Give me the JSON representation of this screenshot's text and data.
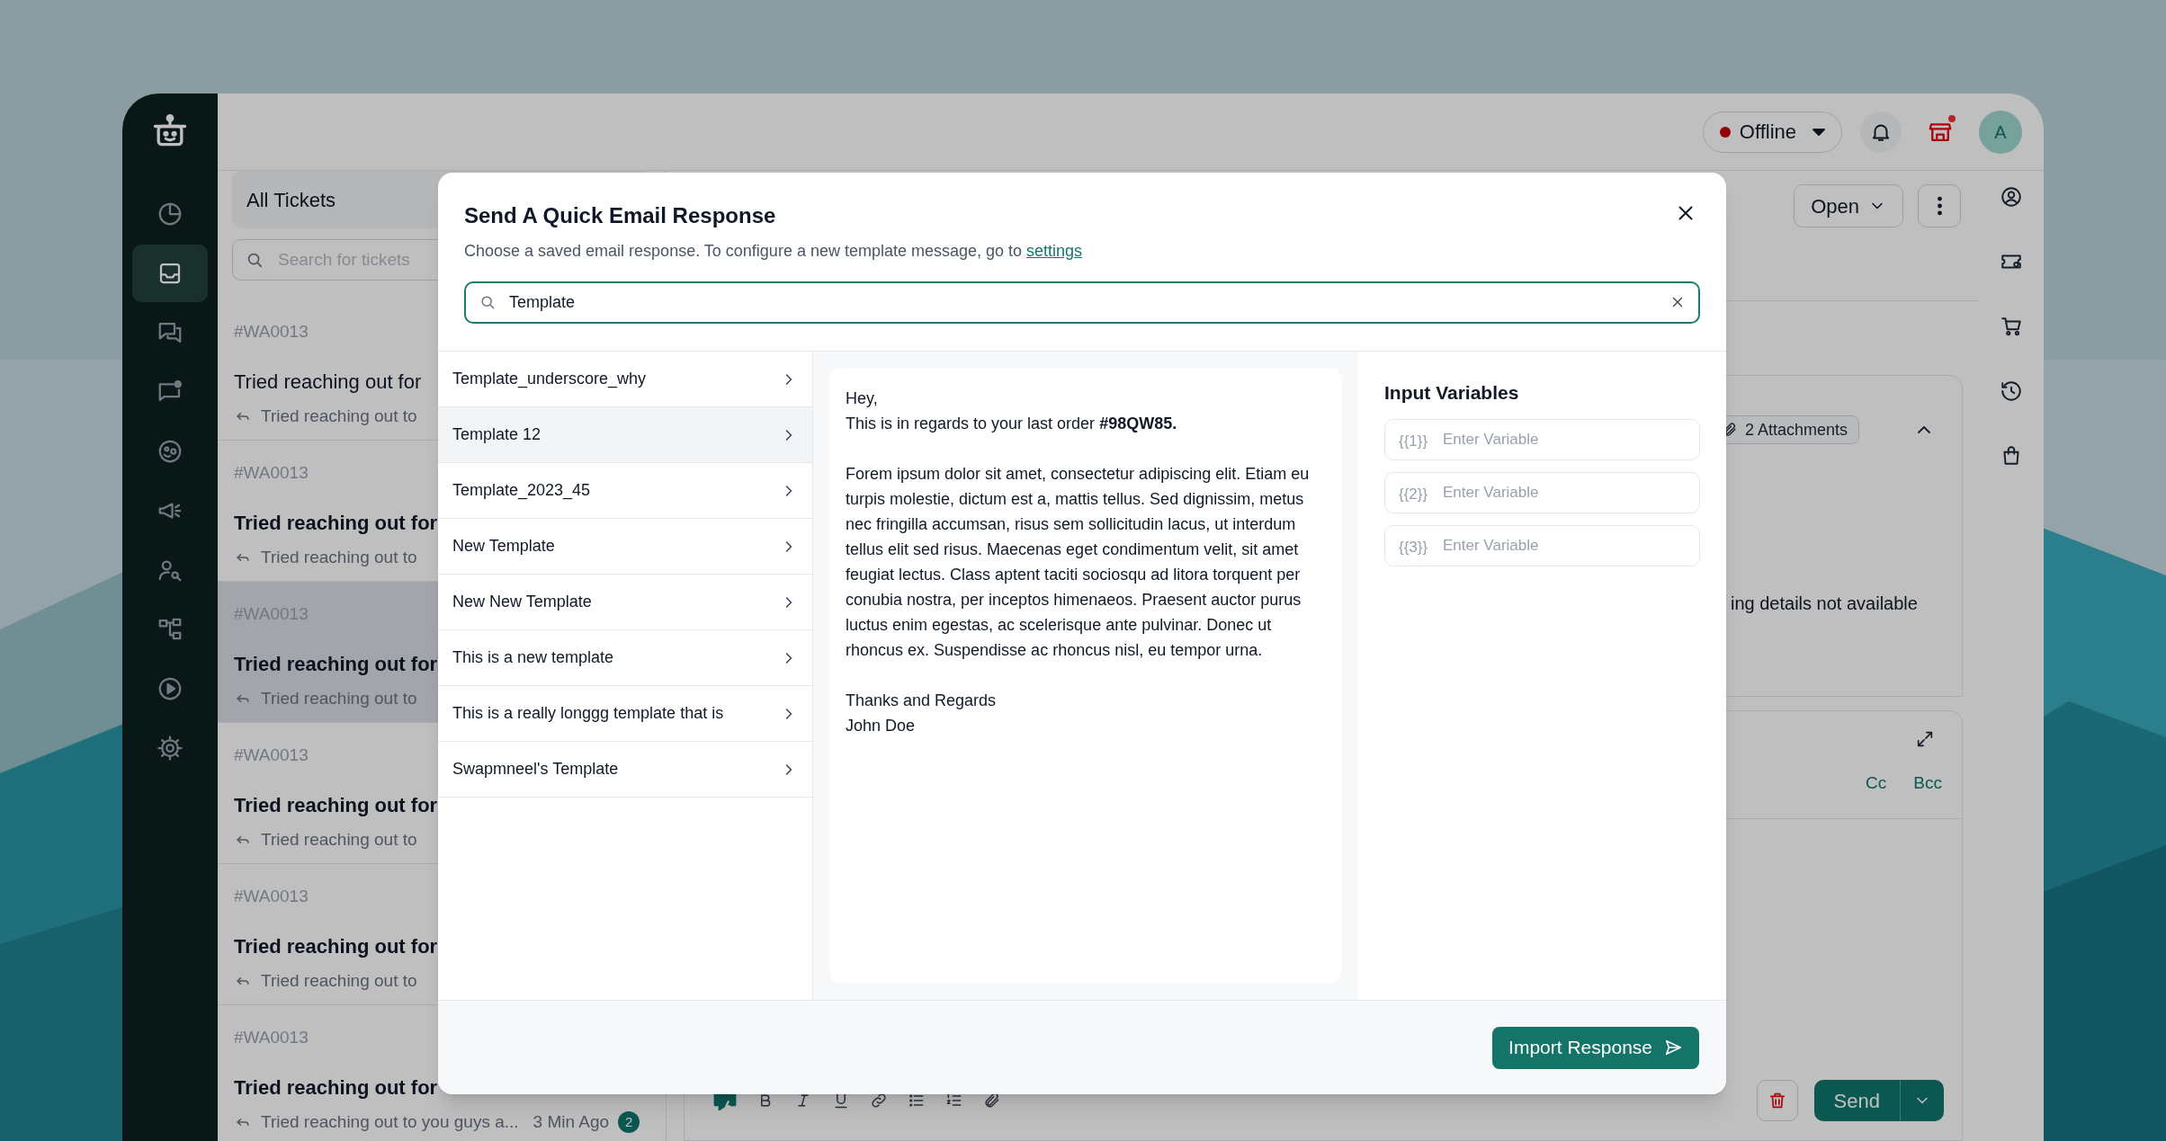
{
  "app": {
    "top_bar": {
      "status": {
        "label": "Offline",
        "online": false
      },
      "store_alert": true,
      "avatar": "A"
    },
    "rail": {
      "items": [
        {
          "selected": false
        },
        {
          "selected": true
        },
        {
          "selected": false
        },
        {
          "selected": false
        },
        {
          "selected": false
        },
        {
          "selected": false
        },
        {
          "selected": false
        },
        {
          "selected": false
        },
        {
          "selected": false
        },
        {
          "selected": false
        }
      ]
    },
    "ticket_list": {
      "title": "All Tickets",
      "search_placeholder": "Search for tickets",
      "tickets": [
        {
          "id": "#WA0013",
          "title": "Tried reaching out for",
          "preview": "Tried reaching out to",
          "unread": false,
          "selected": false
        },
        {
          "id": "#WA0013",
          "title": "Tried reaching out for",
          "preview": "Tried reaching out to",
          "unread": true,
          "selected": false
        },
        {
          "id": "#WA0013",
          "title": "Tried reaching out for",
          "preview": "Tried reaching out to",
          "unread": true,
          "selected": true
        },
        {
          "id": "#WA0013",
          "title": "Tried reaching out for",
          "preview": "Tried reaching out to",
          "unread": true,
          "selected": false
        },
        {
          "id": "#WA0013",
          "title": "Tried reaching out for",
          "preview": "Tried reaching out to",
          "unread": true,
          "selected": false
        },
        {
          "id": "#WA0013",
          "title": "Tried reaching out for",
          "preview": "Tried reaching out to you guys a...",
          "time": "3 Min Ago",
          "count": "2",
          "unread": true,
          "selected": false
        }
      ]
    },
    "conversation": {
      "status_button": "Open",
      "attachments": "2 Attachments",
      "notice": "ing details not available",
      "cc": "Cc",
      "bcc": "Bcc",
      "send": "Send"
    }
  },
  "modal": {
    "title": "Send A Quick Email Response",
    "subtitle": "Choose a saved email response. To configure a new template message, go to",
    "link": "settings",
    "search": {
      "value": "Template"
    },
    "templates": [
      {
        "label": "Template_underscore_why",
        "selected": false
      },
      {
        "label": "Template 12",
        "selected": true
      },
      {
        "label": "Template_2023_45",
        "selected": false
      },
      {
        "label": "New Template",
        "selected": false
      },
      {
        "label": "New New Template",
        "selected": false
      },
      {
        "label": "This is a new template",
        "selected": false
      },
      {
        "label": "This is a really longgg template that is",
        "selected": false
      },
      {
        "label": "Swapmneel's Template",
        "selected": false
      }
    ],
    "preview": [
      {
        "lines": [
          "Hey,",
          "This is in regards to your last order **#98QW85.**"
        ]
      },
      {
        "lines": [
          "Forem ipsum dolor sit amet, consectetur adipiscing elit. Etiam eu turpis molestie, dictum est a, mattis tellus. Sed dignissim, metus nec fringilla accumsan, risus sem sollicitudin lacus, ut interdum tellus elit sed risus. Maecenas eget condimentum velit, sit amet feugiat lectus. Class aptent taciti sociosqu ad litora torquent per conubia nostra, per inceptos himenaeos. Praesent auctor purus luctus enim egestas, ac scelerisque ante pulvinar. Donec ut rhoncus ex. Suspendisse ac rhoncus nisl, eu tempor urna."
        ]
      },
      {
        "lines": [
          "Thanks and Regards",
          "John Doe"
        ]
      }
    ],
    "variables": {
      "title": "Input Variables",
      "fields": [
        {
          "prefix": "{{1}}",
          "placeholder": "Enter Variable"
        },
        {
          "prefix": "{{2}}",
          "placeholder": "Enter Variable"
        },
        {
          "prefix": "{{3}}",
          "placeholder": "Enter Variable"
        }
      ]
    },
    "button": "Import Response"
  }
}
